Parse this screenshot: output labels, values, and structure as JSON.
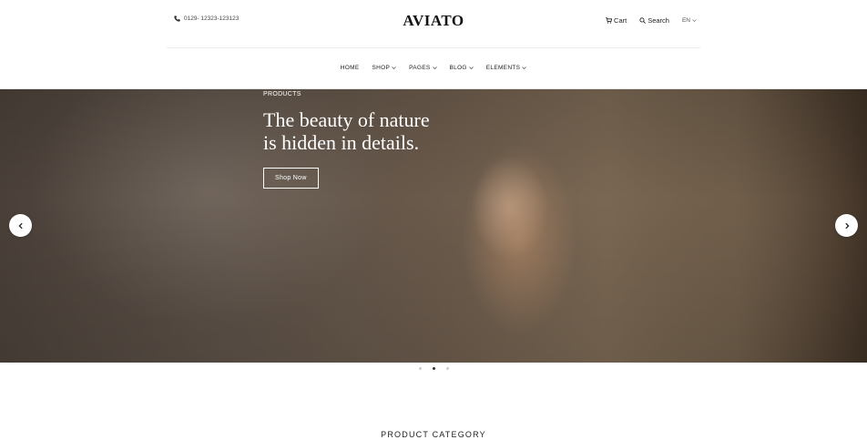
{
  "header": {
    "phone": "0129- 12323-123123",
    "logo": "AVIATO",
    "cart_label": "Cart",
    "search_label": "Search",
    "language": "EN"
  },
  "nav": {
    "items": [
      "HOME",
      "SHOP",
      "PAGES",
      "BLOG",
      "ELEMENTS"
    ]
  },
  "hero": {
    "eyebrow": "PRODUCTS",
    "title_line1": "The beauty of nature",
    "title_line2": "is hidden in details.",
    "button_label": "Shop Now"
  },
  "carousel": {
    "slide_count": 3,
    "active_slide": 2
  },
  "section": {
    "title": "PRODUCT CATEGORY"
  }
}
